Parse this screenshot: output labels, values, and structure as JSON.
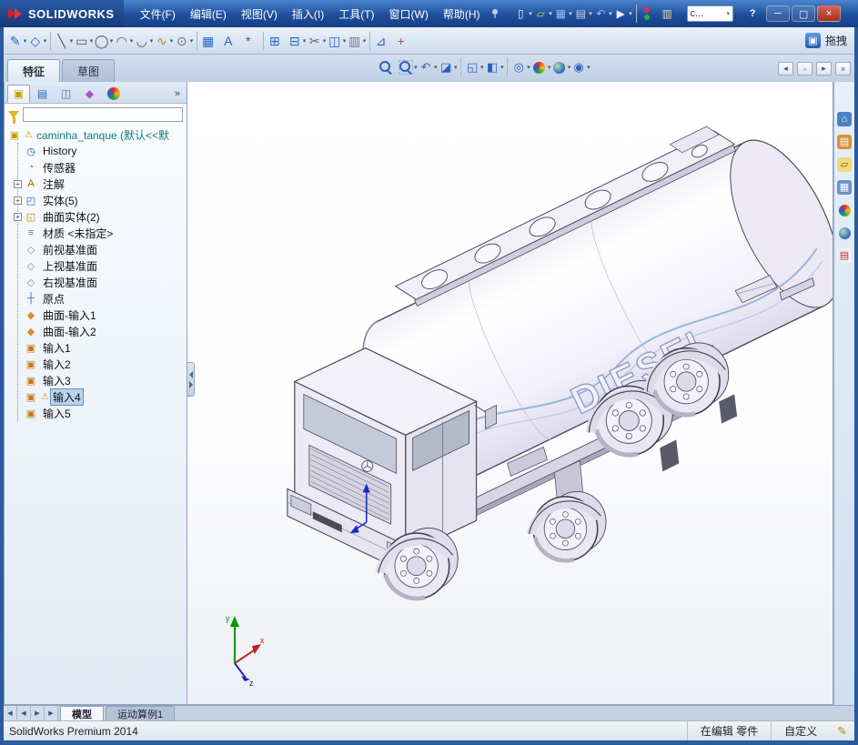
{
  "ui": {
    "caret_glyph": "▾",
    "expander_glyph": "+",
    "warning_glyph": "⚠",
    "overflow_glyph": "»",
    "accent_color": "#2a62c0",
    "selection_color": "#b8d2ee",
    "warning_color": "#cf9600"
  },
  "titlebar": {
    "app_name": "SOLIDWORKS",
    "menus": [
      "文件(F)",
      "编辑(E)",
      "视图(V)",
      "插入(I)",
      "工具(T)",
      "窗口(W)",
      "帮助(H)"
    ],
    "search_value": "c...",
    "window_buttons": [
      {
        "name": "help-button",
        "g": "?",
        "inter": "true"
      },
      {
        "name": "minimize-button",
        "g": "─",
        "inter": "true"
      },
      {
        "name": "maximize-button",
        "g": "▢",
        "inter": "true"
      },
      {
        "name": "close-button",
        "g": "×",
        "inter": "true"
      }
    ]
  },
  "quick_access": [
    {
      "name": "new-document-icon",
      "g": "▯",
      "c": "#eef2fa",
      "caret": true,
      "inter": "true"
    },
    {
      "name": "open-document-icon",
      "g": "▱",
      "c": "#e8c24a",
      "caret": true,
      "inter": "true"
    },
    {
      "name": "save-icon",
      "g": "▦",
      "c": "#8ec0f0",
      "caret": true,
      "inter": "true"
    },
    {
      "name": "print-icon",
      "g": "▤",
      "c": "#d0d8e8",
      "caret": true,
      "inter": "true"
    },
    {
      "name": "undo-icon",
      "g": "↶",
      "c": "#90c0f0",
      "caret": true,
      "inter": "true"
    },
    {
      "name": "select-icon",
      "g": "▶",
      "c": "#e8eef8",
      "caret": true,
      "inter": "true"
    },
    {
      "name": "separator-q1",
      "g": "",
      "inter": "false"
    },
    {
      "name": "status-lights-icon",
      "g": "",
      "inter": "true"
    },
    {
      "name": "clipboard-icon",
      "g": "▥",
      "c": "#e8d8a8",
      "inter": "true"
    }
  ],
  "toolbar_sketch": {
    "drag_label": "拖拽",
    "badge_glyph": "▣",
    "items": [
      {
        "name": "sketch-icon",
        "g": "✎",
        "c": "#2a62c0",
        "caret": true,
        "inter": "true"
      },
      {
        "name": "smart-dimension-icon",
        "g": "◇",
        "c": "#2a62c0",
        "caret": true,
        "inter": "true"
      },
      {
        "name": "separator-1",
        "g": "",
        "inter": "false"
      },
      {
        "name": "line-icon",
        "g": "╲",
        "c": "#44506a",
        "caret": true,
        "inter": "true"
      },
      {
        "name": "rectangle-icon",
        "g": "▭",
        "c": "#44506a",
        "caret": true,
        "inter": "true"
      },
      {
        "name": "circle-icon",
        "g": "◯",
        "c": "#44506a",
        "caret": true,
        "inter": "true"
      },
      {
        "name": "arc-icon",
        "g": "◠",
        "c": "#44506a",
        "caret": true,
        "inter": "true"
      },
      {
        "name": "tangent-arc-icon",
        "g": "◡",
        "c": "#44506a",
        "caret": true,
        "inter": "true"
      },
      {
        "name": "spline-icon",
        "g": "∿",
        "c": "#d07818",
        "caret": true,
        "inter": "true"
      },
      {
        "name": "ellipse-icon",
        "g": "⊙",
        "c": "#66708a",
        "caret": true,
        "inter": "true"
      },
      {
        "name": "separator-2",
        "g": "",
        "inter": "false"
      },
      {
        "name": "sketch-pattern-icon",
        "g": "▦",
        "c": "#2a62c0",
        "inter": "true"
      },
      {
        "name": "text-icon",
        "g": "A",
        "c": "#2a62c0",
        "inter": "true"
      },
      {
        "name": "point-icon",
        "g": "*",
        "c": "#44506a",
        "inter": "true"
      },
      {
        "name": "separator-3",
        "g": "",
        "inter": "false"
      },
      {
        "name": "convert-entities-icon",
        "g": "⊞",
        "c": "#2a62c0",
        "inter": "true"
      },
      {
        "name": "offset-entities-icon",
        "g": "⊟",
        "c": "#2a62c0",
        "caret": true,
        "inter": "true"
      },
      {
        "name": "trim-entities-icon",
        "g": "✂",
        "c": "#55607a",
        "caret": true,
        "inter": "true"
      },
      {
        "name": "mirror-entities-icon",
        "g": "◫",
        "c": "#2a62c0",
        "caret": true,
        "inter": "true"
      },
      {
        "name": "linear-pattern-icon",
        "g": "▥",
        "c": "#6a7890",
        "caret": true,
        "inter": "true"
      },
      {
        "name": "separator-4",
        "g": "",
        "inter": "false"
      },
      {
        "name": "relations-icon",
        "g": "⊿",
        "c": "#2a62c0",
        "inter": "true"
      },
      {
        "name": "repair-sketch-icon",
        "g": "+",
        "c": "#b05050",
        "inter": "true"
      }
    ]
  },
  "command_tabs": [
    {
      "name": "tab-features",
      "label": "特征",
      "active": true,
      "inter": "true"
    },
    {
      "name": "tab-sketch",
      "label": "草图",
      "inter": "true"
    }
  ],
  "headsup": [
    {
      "name": "zoom-fit-icon",
      "g": "",
      "inter": "true"
    },
    {
      "name": "zoom-area-icon",
      "g": "",
      "caret": true,
      "inter": "true"
    },
    {
      "name": "previous-view-icon",
      "g": "↶",
      "c": "#2a62c0",
      "caret": true,
      "inter": "true"
    },
    {
      "name": "section-view-icon",
      "g": "◪",
      "c": "#2a62c0",
      "caret": true,
      "inter": "true"
    },
    {
      "name": "separator-h1",
      "g": "",
      "inter": "false"
    },
    {
      "name": "view-orientation-icon",
      "g": "◱",
      "c": "#2a62c0",
      "caret": true,
      "inter": "true"
    },
    {
      "name": "display-style-icon",
      "g": "◧",
      "c": "#2a62c0",
      "caret": true,
      "inter": "true"
    },
    {
      "name": "separator-h2",
      "g": "",
      "inter": "false"
    },
    {
      "name": "hide-show-icon",
      "g": "◎",
      "c": "#2a62c0",
      "caret": true,
      "inter": "true"
    },
    {
      "name": "edit-appearance-icon",
      "g": "",
      "caret": true,
      "inter": "true"
    },
    {
      "name": "apply-scene-icon",
      "g": "",
      "caret": true,
      "inter": "true"
    },
    {
      "name": "view-settings-icon",
      "g": "◉",
      "c": "#2a62c0",
      "caret": true,
      "inter": "true"
    }
  ],
  "pane_controls": [
    {
      "name": "pane-collapse-left-icon",
      "g": "◂",
      "inter": "true"
    },
    {
      "name": "pane-restore-icon",
      "g": "▫",
      "inter": "true"
    },
    {
      "name": "pane-collapse-right-icon",
      "g": "▸",
      "inter": "true"
    },
    {
      "name": "pane-close-icon",
      "g": "×",
      "inter": "true"
    }
  ],
  "sidebar": {
    "manager_tabs": [
      {
        "name": "featuremanager-tab-icon",
        "g": "▣",
        "c": "#c0a000",
        "active": true,
        "inter": "true"
      },
      {
        "name": "propertymanager-tab-icon",
        "g": "▤",
        "c": "#2a62c0",
        "inter": "true"
      },
      {
        "name": "configurationmanager-tab-icon",
        "g": "◫",
        "c": "#3a72c8",
        "inter": "true"
      },
      {
        "name": "dimxpertmanager-tab-icon",
        "g": "◆",
        "c": "#b050c0",
        "inter": "true"
      },
      {
        "name": "displaymanager-tab-icon",
        "g": "",
        "inter": "true"
      }
    ],
    "filter": {
      "value": ""
    },
    "tree": {
      "root": {
        "label": "caminha_tanque (默认<<默",
        "part_glyph": "▣"
      },
      "items": [
        {
          "label": "History",
          "icon": "history-icon",
          "g": "◷",
          "c": "#1c56b0"
        },
        {
          "label": "传感器",
          "icon": "sensors-icon",
          "g": "◔",
          "c": "#c08000"
        },
        {
          "label": "注解",
          "icon": "annotations-icon",
          "g": "A",
          "c": "#a86000",
          "expand": true
        },
        {
          "label": "实体(5)",
          "icon": "solid-bodies-icon",
          "g": "◰",
          "c": "#2a62c0",
          "expand": true
        },
        {
          "label": "曲面实体(2)",
          "icon": "surface-bodies-icon",
          "g": "◱",
          "c": "#d08000",
          "expand": true
        },
        {
          "label": "材质 <未指定>",
          "icon": "material-icon",
          "g": "≡",
          "c": "#667788"
        },
        {
          "label": "前视基准面",
          "icon": "plane-icon",
          "g": "◇",
          "c": "#8090ae"
        },
        {
          "label": "上视基准面",
          "icon": "plane-icon",
          "g": "◇",
          "c": "#8090ae"
        },
        {
          "label": "右视基准面",
          "icon": "plane-icon",
          "g": "◇",
          "c": "#8090ae"
        },
        {
          "label": "原点",
          "icon": "origin-icon",
          "g": "┼",
          "c": "#2a62c0"
        },
        {
          "label": "曲面-输入1",
          "icon": "surface-import-icon",
          "g": "◆",
          "c": "#d89020"
        },
        {
          "label": "曲面-输入2",
          "icon": "surface-import-icon",
          "g": "◆",
          "c": "#d89020"
        },
        {
          "label": "输入1",
          "icon": "import-icon",
          "g": "▣",
          "c": "#c87818"
        },
        {
          "label": "输入2",
          "icon": "import-icon",
          "g": "▣",
          "c": "#c87818"
        },
        {
          "label": "输入3",
          "icon": "import-icon",
          "g": "▣",
          "c": "#c87818"
        },
        {
          "label": "输入4",
          "icon": "import-icon",
          "g": "▣",
          "c": "#c87818",
          "warn": true,
          "selected": true
        },
        {
          "label": "输入5",
          "icon": "import-icon",
          "g": "▣",
          "c": "#c87818"
        }
      ]
    }
  },
  "viewport": {
    "tank_text": "DIESEL",
    "triad": {
      "x": "x",
      "y": "y",
      "z": "z"
    }
  },
  "taskpane": [
    {
      "name": "task-pane-resources-icon",
      "g": "⌂",
      "c": "#ffffff",
      "bg": "#4a80c8",
      "inter": "true"
    },
    {
      "name": "task-pane-design-library-icon",
      "g": "▤",
      "c": "#ffffff",
      "bg": "#d8923a",
      "inter": "true"
    },
    {
      "name": "task-pane-file-explorer-icon",
      "g": "▱",
      "c": "#7a5c10",
      "bg": "#f0d878",
      "inter": "true"
    },
    {
      "name": "task-pane-view-palette-icon",
      "g": "▦",
      "c": "#ffffff",
      "bg": "#6a94c8",
      "inter": "true"
    },
    {
      "name": "task-pane-appearances-icon",
      "g": "",
      "inter": "true"
    },
    {
      "name": "task-pane-scenes-icon",
      "g": "",
      "inter": "true"
    },
    {
      "name": "task-pane-custom-properties-icon",
      "g": "▤",
      "c": "#c03030",
      "bg": "#eef0f4",
      "inter": "true"
    }
  ],
  "bottom": {
    "nav": [
      {
        "name": "model-tabs-first-icon",
        "g": "◀",
        "inter": "true"
      },
      {
        "name": "model-tabs-prev-icon",
        "g": "◀",
        "inter": "true"
      },
      {
        "name": "model-tabs-next-icon",
        "g": "▶",
        "inter": "true"
      },
      {
        "name": "model-tabs-last-icon",
        "g": "▶",
        "inter": "true"
      }
    ],
    "tabs": [
      {
        "name": "model-tab",
        "label": "模型",
        "active": true,
        "inter": "true"
      },
      {
        "name": "motion-study-tab",
        "label": "运动算例1",
        "inter": "true"
      }
    ]
  },
  "statusbar": {
    "product": "SolidWorks Premium 2014",
    "editing": "在编辑 零件",
    "custom": "自定义",
    "pencil_glyph": "✎"
  }
}
